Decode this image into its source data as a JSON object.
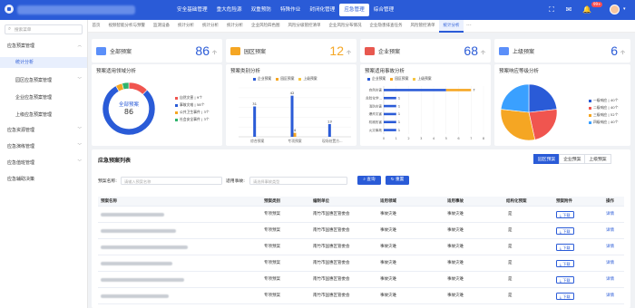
{
  "topnav": {
    "items": [
      "安全基础管理",
      "重大危险源",
      "双重预防",
      "特殊作业",
      "封闭化管理",
      "应急管理",
      "综合管理"
    ],
    "active_index": 5,
    "badge": "99+"
  },
  "sidebar": {
    "search_placeholder": "搜索菜单",
    "items": [
      {
        "label": "应急预案管理",
        "level": 0,
        "expanded": true
      },
      {
        "label": "统计分析",
        "level": 1,
        "active": true
      },
      {
        "label": "园区应急预案管理",
        "level": 1,
        "expandable": true
      },
      {
        "label": "企业应急预案管理",
        "level": 1
      },
      {
        "label": "上级应急预案管理",
        "level": 1
      },
      {
        "label": "应急资源管理",
        "level": 0
      },
      {
        "label": "应急演练管理",
        "level": 0
      },
      {
        "label": "应急值班管理",
        "level": 0
      },
      {
        "label": "应急辅助决策",
        "level": 0
      }
    ]
  },
  "tabs": {
    "items": [
      "首页",
      "视频智能分析与预警",
      "监测设备",
      "统计分析",
      "统计分析",
      "统计分析",
      "企业风险四色图",
      "风险分级管控清单",
      "企业风险分布情况",
      "企业隐患排查任务",
      "风险管控清单",
      "统计分析"
    ],
    "active_index": 11,
    "more": "···"
  },
  "kpis": [
    {
      "label": "全部预案",
      "value": "86",
      "unit": "个",
      "color": "#2a5bd7",
      "icon_color": "#5b8ff9"
    },
    {
      "label": "园区预案",
      "value": "12",
      "unit": "个",
      "color": "#f5a623",
      "icon_color": "#f5a623"
    },
    {
      "label": "企业预案",
      "value": "68",
      "unit": "个",
      "color": "#e8584f",
      "icon_color": "#e8584f"
    },
    {
      "label": "上级预案",
      "value": "6",
      "unit": "个",
      "color": "#2a5bd7",
      "icon_color": "#5b8ff9"
    }
  ],
  "donut": {
    "title": "预案适用领域分析",
    "center_label": "全部预案",
    "center_value": "86",
    "legend": [
      {
        "label": "自然灾害 | 9个",
        "color": "#f0554f"
      },
      {
        "label": "事故灾难 | 58个",
        "color": "#2a5bd7"
      },
      {
        "label": "公共卫生事件 | 3个",
        "color": "#f5a623"
      },
      {
        "label": "社会安全事件 | 3个",
        "color": "#2fb36c"
      }
    ]
  },
  "bar_chart": {
    "title": "预案类别分析",
    "legend": [
      "企业预案",
      "园区预案",
      "上级预案"
    ],
    "colors": [
      "#2a5bd7",
      "#f5a623",
      "#f5c542"
    ]
  },
  "hbar_chart": {
    "title": "预案适用事故分析",
    "legend": [
      "企业预案",
      "园区预案",
      "上级预案"
    ],
    "colors": [
      "#2a5bd7",
      "#f5a623",
      "#f5c542"
    ]
  },
  "pie": {
    "title": "预案响应等级分析",
    "legend": [
      {
        "label": "一级响应 | 40个",
        "color": "#2a5bd7"
      },
      {
        "label": "二级响应 | 40个",
        "color": "#f0554f"
      },
      {
        "label": "三级响应 | 52个",
        "color": "#f5a623"
      },
      {
        "label": "四级响应 | 40个",
        "color": "#3aa0ff"
      }
    ]
  },
  "chart_data": [
    {
      "type": "pie",
      "title": "预案适用领域分析",
      "categories": [
        "自然灾害",
        "事故灾难",
        "公共卫生事件",
        "社会安全事件"
      ],
      "values": [
        9,
        58,
        3,
        3
      ]
    },
    {
      "type": "bar",
      "title": "预案类别分析",
      "categories": [
        "综合预案",
        "专项预案",
        "现场处置方..."
      ],
      "series": [
        {
          "name": "企业预案",
          "values": [
            31,
            42,
            13
          ]
        },
        {
          "name": "园区预案",
          "values": [
            0,
            4,
            0
          ]
        },
        {
          "name": "上级预案",
          "values": [
            0,
            0,
            0
          ]
        }
      ],
      "ylim": [
        0,
        50
      ]
    },
    {
      "type": "bar",
      "orientation": "horizontal",
      "title": "预案适用事故分析",
      "categories": [
        "自然灾害",
        "危险化学...",
        "消防灾害",
        "爆炸灾害",
        "机械伤害",
        "火灾事故"
      ],
      "series": [
        {
          "name": "企业预案",
          "values": [
            5,
            1,
            1,
            1,
            1,
            1
          ]
        },
        {
          "name": "园区预案",
          "values": [
            2,
            0,
            0,
            0,
            0,
            0
          ]
        },
        {
          "name": "上级预案",
          "values": [
            0,
            0,
            0,
            0,
            0,
            0
          ]
        }
      ],
      "data_labels": [
        7,
        1,
        1,
        1,
        1,
        1
      ],
      "xticks": [
        0,
        1,
        2,
        3,
        4,
        5,
        6,
        7,
        8
      ],
      "xlim": [
        0,
        8
      ]
    },
    {
      "type": "pie",
      "title": "预案响应等级分析",
      "categories": [
        "一级响应",
        "二级响应",
        "三级响应",
        "四级响应"
      ],
      "values": [
        40,
        40,
        52,
        40
      ]
    }
  ],
  "table": {
    "title": "应急预案列表",
    "view_buttons": [
      "园区预案",
      "企业预案",
      "上级预案"
    ],
    "active_view": 0,
    "filters": {
      "name_label": "预案名称:",
      "name_placeholder": "请输入预案名称",
      "type_label": "适用事故:",
      "type_placeholder": "请选择事故类型",
      "query": "查询",
      "reset": "重置"
    },
    "columns": [
      "预案名称",
      "预案类别",
      "编制单位",
      "适用领域",
      "适用事故",
      "结构化预案",
      "预案附件",
      "操作"
    ],
    "rows": [
      {
        "category": "专项预案",
        "unit": "南竹市国惠区管委会",
        "domain": "事故灾难",
        "accident": "事故灾难",
        "structured": "是",
        "attachment": "下载",
        "action": "详情"
      },
      {
        "category": "专项预案",
        "unit": "南竹市国惠区管委会",
        "domain": "事故灾难",
        "accident": "事故灾难",
        "structured": "是",
        "attachment": "下载",
        "action": "详情"
      },
      {
        "category": "专项预案",
        "unit": "南竹市国惠区管委会",
        "domain": "事故灾难",
        "accident": "事故灾难",
        "structured": "是",
        "attachment": "下载",
        "action": "详情"
      },
      {
        "category": "专项预案",
        "unit": "南竹市国惠区管委会",
        "domain": "事故灾难",
        "accident": "事故灾难",
        "structured": "是",
        "attachment": "下载",
        "action": "详情"
      },
      {
        "category": "专项预案",
        "unit": "南竹市国惠区管委会",
        "domain": "事故灾难",
        "accident": "事故灾难",
        "structured": "是",
        "attachment": "下载",
        "action": "详情"
      },
      {
        "category": "专项预案",
        "unit": "南竹市国惠区管委会",
        "domain": "事故灾难",
        "accident": "事故灾难",
        "structured": "是",
        "attachment": "下载",
        "action": "详情"
      }
    ]
  }
}
